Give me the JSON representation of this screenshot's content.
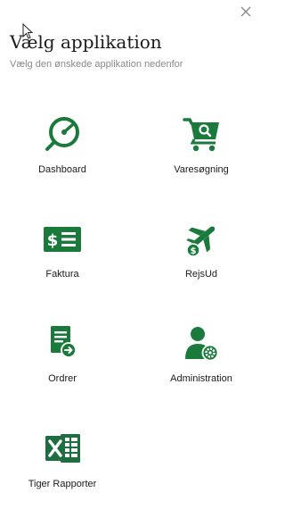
{
  "dialog": {
    "title": "Vælg applikation",
    "subtitle": "Vælg den ønskede applikation nedenfor",
    "close_icon": "close-icon"
  },
  "colors": {
    "brand_green": "#1a7a3c",
    "excel_green": "#1e6e41"
  },
  "apps": [
    {
      "label": "Dashboard",
      "icon": "gauge-icon"
    },
    {
      "label": "Varesøgning",
      "icon": "cart-search-icon"
    },
    {
      "label": "Faktura",
      "icon": "invoice-money-icon"
    },
    {
      "label": "RejsUd",
      "icon": "plane-money-icon"
    },
    {
      "label": "Ordrer",
      "icon": "order-document-icon"
    },
    {
      "label": "Administration",
      "icon": "user-settings-icon"
    },
    {
      "label": "Tiger Rapporter",
      "icon": "excel-icon"
    }
  ]
}
